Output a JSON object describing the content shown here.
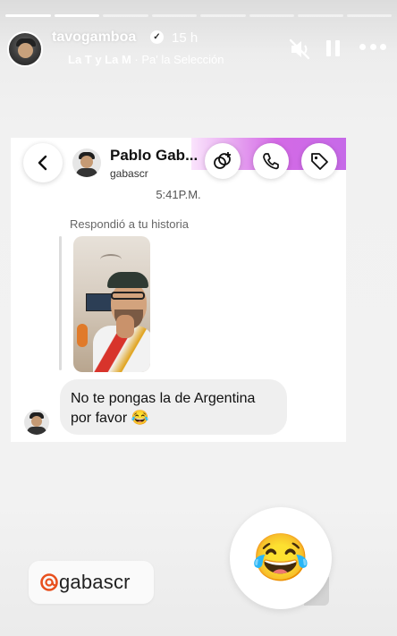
{
  "story": {
    "progress_segments": 8,
    "progress_completed": 2,
    "username": "tavogamboa",
    "time_ago": "15 h",
    "music_artist": "La T y La M",
    "music_separator": " · ",
    "music_song": "Pa' la Selección",
    "icons": [
      "mute-icon",
      "pause-icon",
      "more-icon",
      "verified-badge-icon"
    ]
  },
  "dm": {
    "contact_name": "Pablo Gab...",
    "contact_handle": "gabascr",
    "timestamp": "5:41P.M.",
    "replied_label": "Respondió a tu historia",
    "message_text": "No te pongas la de Argentina por favor 😂",
    "icons": [
      "back-arrow-icon",
      "sticker-add-icon",
      "phone-icon",
      "tag-icon"
    ],
    "accent_color": "#d46ae6"
  },
  "mention": {
    "handle": "gabascr",
    "icon": "threads-icon"
  },
  "reaction": {
    "emoji": "😂"
  }
}
